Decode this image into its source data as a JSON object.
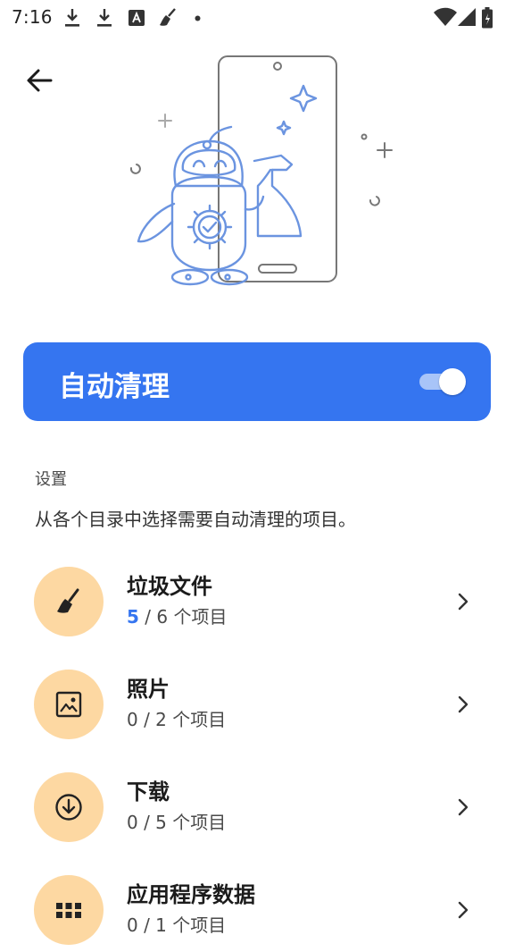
{
  "status_bar": {
    "time": "7:16"
  },
  "auto_clean": {
    "title": "自动清理",
    "enabled": true
  },
  "settings": {
    "label": "设置",
    "description": "从各个目录中选择需要自动清理的项目。"
  },
  "categories": [
    {
      "title": "垃圾文件",
      "selected": "5",
      "rest": " / 6 个项目",
      "icon": "broom-icon"
    },
    {
      "title": "照片",
      "selected": "",
      "rest": "0 / 2 个项目",
      "icon": "image-icon"
    },
    {
      "title": "下载",
      "selected": "",
      "rest": "0 / 5 个项目",
      "icon": "download-circle-icon"
    },
    {
      "title": "应用程序数据",
      "selected": "",
      "rest": "0 / 1 个项目",
      "icon": "apps-grid-icon"
    }
  ],
  "colors": {
    "accent": "#3575f0",
    "icon_circle": "#fdd8a2",
    "illustration_stroke": "#6b94e0"
  }
}
